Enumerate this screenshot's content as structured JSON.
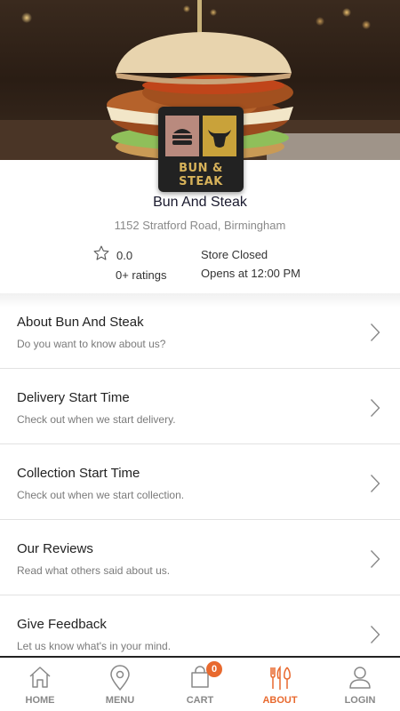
{
  "store": {
    "name": "Bun And Steak",
    "address": "1152 Stratford Road, Birmingham",
    "logo_text": "BUN & STEAK",
    "rating_value": "0.0",
    "rating_count": "0+ ratings",
    "status": "Store Closed",
    "opens": "Opens at 12:00 PM"
  },
  "list": {
    "items": [
      {
        "title": "About Bun And Steak",
        "subtitle": "Do you want to know about us?"
      },
      {
        "title": "Delivery Start Time",
        "subtitle": "Check out when we start delivery."
      },
      {
        "title": "Collection Start Time",
        "subtitle": "Check out when we start collection."
      },
      {
        "title": "Our Reviews",
        "subtitle": "Read what others said about us."
      },
      {
        "title": "Give Feedback",
        "subtitle": "Let us know what's in your mind."
      }
    ]
  },
  "nav": {
    "home": "HOME",
    "menu": "MENU",
    "cart": "CART",
    "cart_count": "0",
    "about": "ABOUT",
    "login": "LOGIN"
  },
  "colors": {
    "accent": "#e8692e",
    "text_primary": "#1a1a2e",
    "text_secondary": "#8a8a8a"
  },
  "icons": [
    "star-icon",
    "chevron-right-icon",
    "home-icon",
    "location-pin-icon",
    "shopping-bag-icon",
    "cutlery-icon",
    "user-icon"
  ]
}
